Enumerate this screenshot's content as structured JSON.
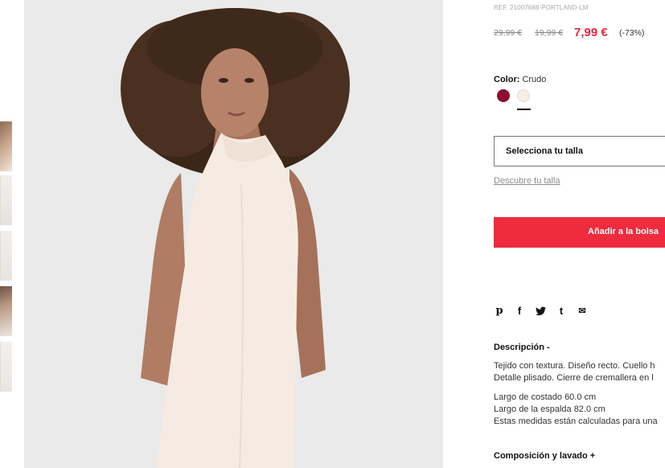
{
  "product": {
    "reference": "REF. 21007688-PORTLAND-LM",
    "price_original": "29,99 €",
    "price_previous": "19,99 €",
    "price_current": "7,99 €",
    "discount": "(-73%)"
  },
  "color": {
    "label": "Color:",
    "value": "Crudo",
    "swatches": [
      {
        "name": "burgundy",
        "hex": "#8e0d32"
      },
      {
        "name": "crudo",
        "hex": "#f5efe4",
        "selected": true
      }
    ]
  },
  "size": {
    "select_label": "Selecciona tu talla",
    "guide_link": "Descubre tu talla"
  },
  "actions": {
    "add_to_bag": "Añadir a la bolsa"
  },
  "share": {
    "icons": [
      "pinterest-icon",
      "facebook-icon",
      "twitter-icon",
      "tumblr-icon",
      "email-icon"
    ],
    "glyphs": {
      "pinterest": "p",
      "facebook": "f",
      "twitter": "t",
      "tumblr": "t",
      "email": "✉"
    }
  },
  "description": {
    "title": "Descripción  -",
    "lines": [
      "Tejido con textura. Diseño recto. Cuello h",
      "Detalle plisado. Cierre de cremallera en l",
      "Largo de costado 60.0 cm",
      "Largo de la espalda 82.0 cm",
      "Estas medidas están calculadas para una"
    ]
  },
  "composition": {
    "title": "Composición y lavado  +"
  },
  "colors": {
    "accent_red": "#ef2b3e",
    "price_red": "#e6283b",
    "image_background": "#e9eae9"
  }
}
